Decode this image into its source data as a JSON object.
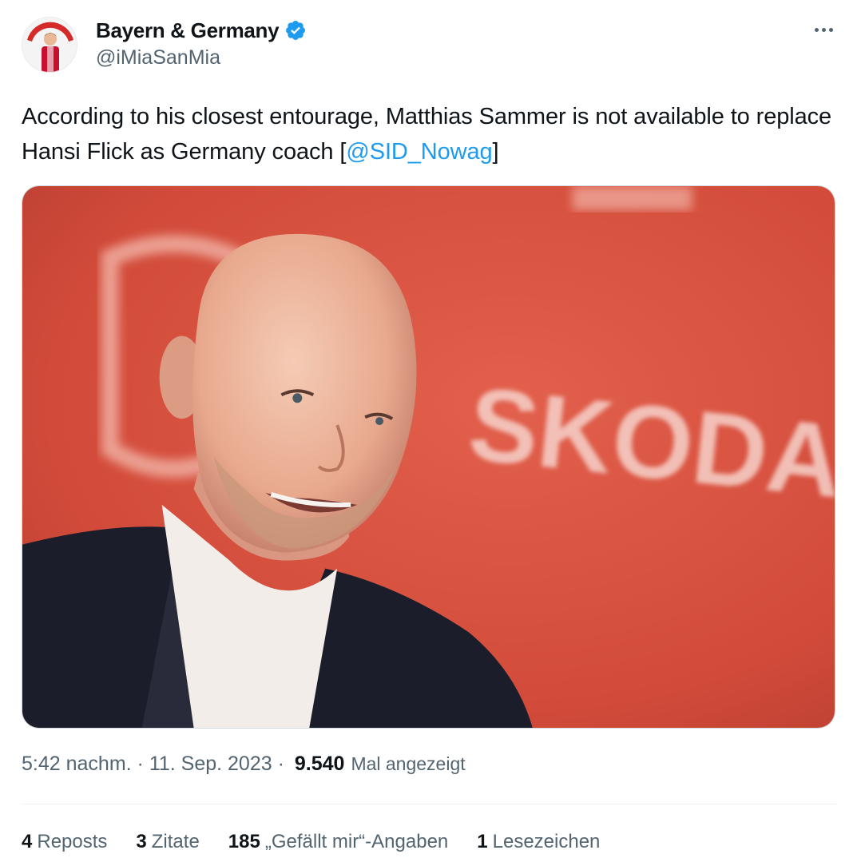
{
  "author": {
    "display_name": "Bayern & Germany",
    "handle": "@iMiaSanMia",
    "verified": true,
    "avatar_icon": "profile-avatar-icon"
  },
  "tweet": {
    "text_before": "According to his closest entourage, Matthias Sammer is not available to replace Hansi Flick as Germany coach [",
    "mention": "@SID_Nowag",
    "text_after": "]"
  },
  "media": {
    "backdrop_text": "SKODA",
    "background_color": "#d8513f",
    "description": "photo-of-bald-man-smiling"
  },
  "meta": {
    "time": "5:42 nachm.",
    "separator": " · ",
    "date": "11. Sep. 2023",
    "views_count": "9.540",
    "views_label": "Mal angezeigt"
  },
  "stats": [
    {
      "count": "4",
      "label": "Reposts"
    },
    {
      "count": "3",
      "label": "Zitate"
    },
    {
      "count": "185",
      "label": "„Gefällt mir“-Angaben"
    },
    {
      "count": "1",
      "label": "Lesezeichen"
    }
  ],
  "colors": {
    "accent": "#1d9bf0",
    "secondary_text": "#536471",
    "primary_text": "#0f1419"
  }
}
